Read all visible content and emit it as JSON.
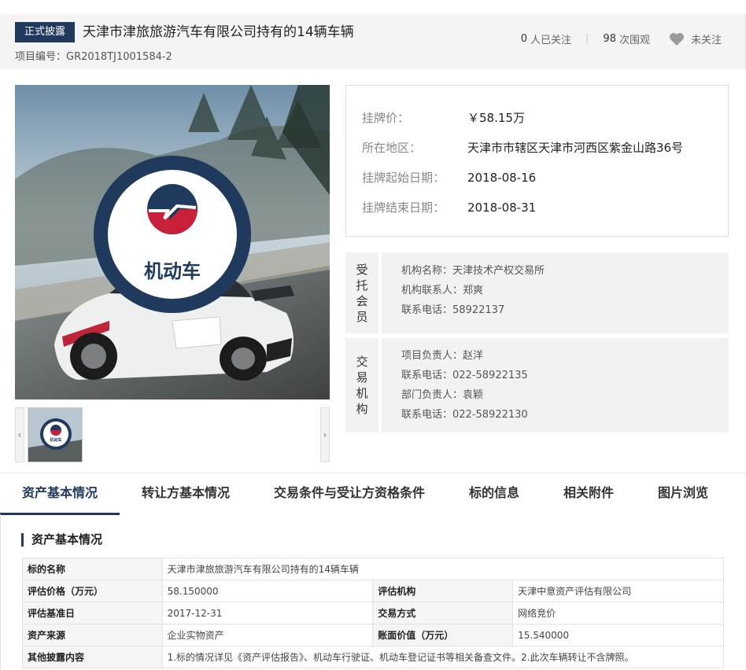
{
  "header": {
    "badge": "正式披露",
    "title": "天津市津旅旅游汽车有限公司持有的14辆车辆",
    "project_no": "项目编号：GR2018TJ1001584-2",
    "follow_count": "0",
    "follow_label": "人已关注",
    "view_count": "98",
    "view_label": "次围观",
    "unfollowed_label": "未关注"
  },
  "image": {
    "circle_label": "机动车",
    "thumb_label": "机动车"
  },
  "price": {
    "rows": [
      {
        "k": "挂牌价：",
        "v": "￥58.15万"
      },
      {
        "k": "所在地区：",
        "v": "天津市市辖区天津市河西区紫金山路36号"
      },
      {
        "k": "挂牌起始日期：",
        "v": "2018-08-16"
      },
      {
        "k": "挂牌结束日期：",
        "v": "2018-08-31"
      }
    ]
  },
  "trustee": {
    "side": [
      "受",
      "托",
      "会",
      "员"
    ],
    "rows": [
      "机构名称：天津技术产权交易所",
      "机构联系人：郑爽",
      "联系电话：58922137"
    ]
  },
  "exchange": {
    "side": [
      "交",
      "易",
      "机",
      "构"
    ],
    "rows": [
      "项目负责人：赵洋",
      "联系电话：022-58922135",
      "部门负责人：袁颖",
      "联系电话：022-58922130"
    ]
  },
  "tabs": [
    "资产基本情况",
    "转让方基本情况",
    "交易条件与受让方资格条件",
    "标的信息",
    "相关附件",
    "图片浏览"
  ],
  "section": {
    "title": "资产基本情况",
    "row1": {
      "k": "标的名称",
      "v": "天津市津旅旅游汽车有限公司持有的14辆车辆"
    },
    "row2": {
      "k1": "评估价格（万元）",
      "v1": "58.150000",
      "k2": "评估机构",
      "v2": "天津中意资产评估有限公司"
    },
    "row3": {
      "k1": "评估基准日",
      "v1": "2017-12-31",
      "k2": "交易方式",
      "v2": "网络竞价"
    },
    "row4": {
      "k1": "资产来源",
      "v1": "企业实物资产",
      "k2": "账面价值（万元）",
      "v2": "15.540000"
    },
    "row5": {
      "k": "其他披露内容",
      "v": "1.标的情况详见《资产评估报告》、机动车行驶证、机动车登记证书等相关备查文件。2.此次车辆转让不含牌照。"
    }
  },
  "colors": {
    "brand": "#1f3a5c",
    "logo_red": "#c8203a"
  }
}
